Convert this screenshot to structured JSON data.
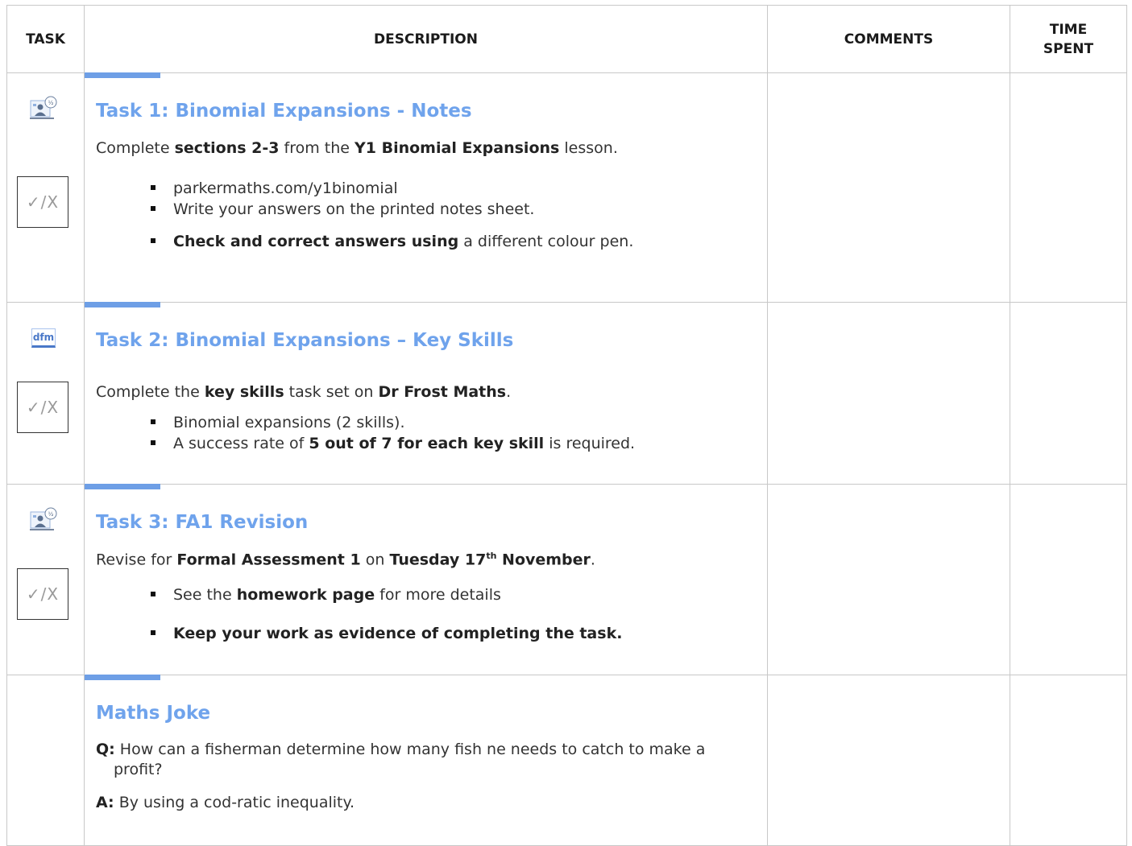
{
  "header": {
    "task": "TASK",
    "description": "DESCRIPTION",
    "comments": "COMMENTS",
    "time_line1": "TIME",
    "time_line2": "SPENT"
  },
  "tick_label": "✓/X",
  "task1": {
    "icon": "teacher-lesson-icon",
    "title": "Task 1: Binomial Expansions - Notes",
    "lead_pre": "Complete ",
    "lead_b1": "sections 2-3",
    "lead_mid": " from the ",
    "lead_b2": "Y1 Binomial Expansions",
    "lead_post": " lesson.",
    "bullet1": "parkermaths.com/y1binomial",
    "bullet2": "Write your answers on the printed notes sheet.",
    "bullet3_b": "Check and correct answers using",
    "bullet3_post": " a different colour pen."
  },
  "task2": {
    "icon": "dfm-icon",
    "icon_text": "dfm",
    "title": "Task 2: Binomial Expansions – Key Skills",
    "lead_pre": "Complete the ",
    "lead_b1": "key skills",
    "lead_mid": " task set on ",
    "lead_b2": "Dr Frost Maths",
    "lead_post": ".",
    "bullet1": "Binomial expansions (2 skills).",
    "bullet2_pre": "A success rate of ",
    "bullet2_b": "5 out of 7 for each key skill",
    "bullet2_post": " is required."
  },
  "task3": {
    "icon": "teacher-lesson-icon",
    "title": "Task 3: FA1 Revision",
    "lead_pre": "Revise for ",
    "lead_b1": "Formal Assessment 1",
    "lead_mid": " on ",
    "lead_b2": "Tuesday 17",
    "lead_sup": "th",
    "lead_b3": " November",
    "lead_post": ".",
    "bullet1_pre": "See the ",
    "bullet1_b": "homework page",
    "bullet1_post": " for more details",
    "bullet2_b": "Keep your work as evidence of completing the task."
  },
  "joke": {
    "title": "Maths Joke",
    "q_label": "Q:",
    "q_text": " How can a fisherman determine how many fish ne needs to catch to make a profit?",
    "a_label": "A:",
    "a_text": " By using a cod-ratic inequality."
  },
  "colors": {
    "title_blue": "#6fa3ec",
    "bar_blue": "#6e9fe6",
    "border": "#c8c8c8"
  }
}
